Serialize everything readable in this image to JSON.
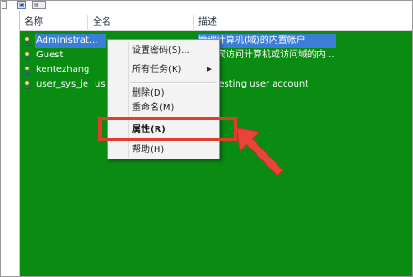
{
  "header": {
    "col_name": "名称",
    "col_fullname": "全名",
    "col_description": "描述"
  },
  "users": [
    {
      "name": "Administrat...",
      "fullname": "",
      "description": "管理计算机(域)的内置帐户",
      "selected": true
    },
    {
      "name": "Guest",
      "fullname": "",
      "description": "供来宾访问计算机或访问域的内..."
    },
    {
      "name": "kentezhang",
      "fullname": "",
      "description": ""
    },
    {
      "name": "user_sys_je",
      "fullname": "us",
      "description": "ast testing user account"
    }
  ],
  "context_menu": {
    "set_password": "设置密码(S)...",
    "all_tasks": "所有任务(K)",
    "all_tasks_arrow": "▶",
    "delete": "删除(D)",
    "rename": "重命名(M)",
    "properties": "属性(R)",
    "help": "帮助(H)"
  },
  "colors": {
    "list_background": "#0a8b12",
    "selection": "#3b7ed8",
    "highlight": "#e13d2f"
  },
  "icons": {
    "user": "user-icon",
    "arrow": "red-pointer-arrow-icon"
  }
}
